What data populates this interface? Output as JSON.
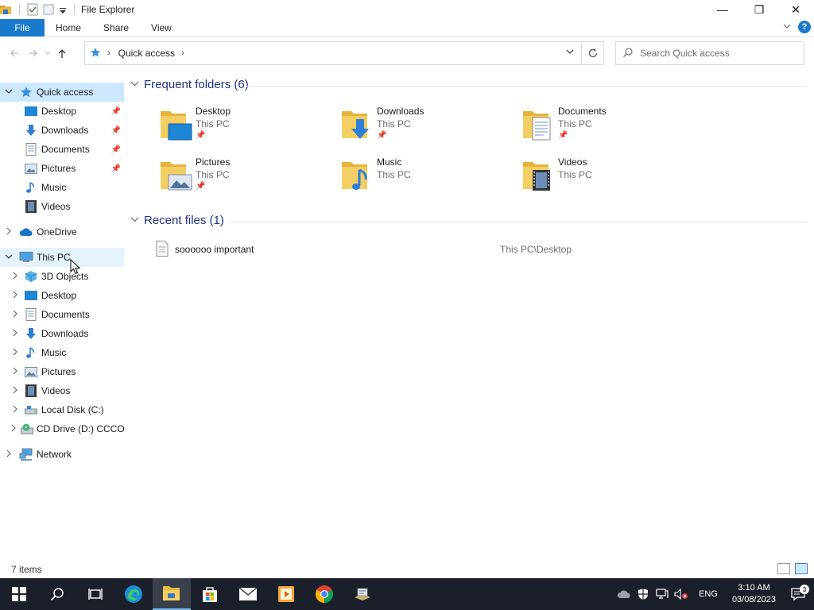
{
  "window": {
    "title": "File Explorer",
    "controls": {
      "minimize": "—",
      "restore": "❐",
      "close": "✕"
    }
  },
  "ribbon": {
    "tabs": [
      "File",
      "Home",
      "Share",
      "View"
    ],
    "help": "?"
  },
  "address": {
    "crumb": "Quick access",
    "search_placeholder": "Search Quick access"
  },
  "sidebar": {
    "quick_access": "Quick access",
    "quick_items": [
      "Desktop",
      "Downloads",
      "Documents",
      "Pictures",
      "Music",
      "Videos"
    ],
    "onedrive": "OneDrive",
    "this_pc": "This PC",
    "pc_items": [
      "3D Objects",
      "Desktop",
      "Documents",
      "Downloads",
      "Music",
      "Pictures",
      "Videos",
      "Local Disk (C:)",
      "CD Drive (D:) CCCO"
    ],
    "network": "Network"
  },
  "frequent": {
    "header": "Frequent folders (6)",
    "folders": [
      {
        "name": "Desktop",
        "location": "This PC"
      },
      {
        "name": "Downloads",
        "location": "This PC"
      },
      {
        "name": "Documents",
        "location": "This PC"
      },
      {
        "name": "Pictures",
        "location": "This PC"
      },
      {
        "name": "Music",
        "location": "This PC"
      },
      {
        "name": "Videos",
        "location": "This PC"
      }
    ]
  },
  "recent": {
    "header": "Recent files (1)",
    "files": [
      {
        "name": "soooooo important",
        "location": "This PC\\Desktop"
      }
    ]
  },
  "status": {
    "count": "7 items"
  },
  "taskbar": {
    "lang": "ENG",
    "time": "3:10 AM",
    "date": "03/08/2023",
    "notifications": "3"
  },
  "colors": {
    "accent": "#1979ca",
    "selection": "#cce8ff",
    "folder": "#f0c24b",
    "taskbar": "#1b1f2a"
  }
}
